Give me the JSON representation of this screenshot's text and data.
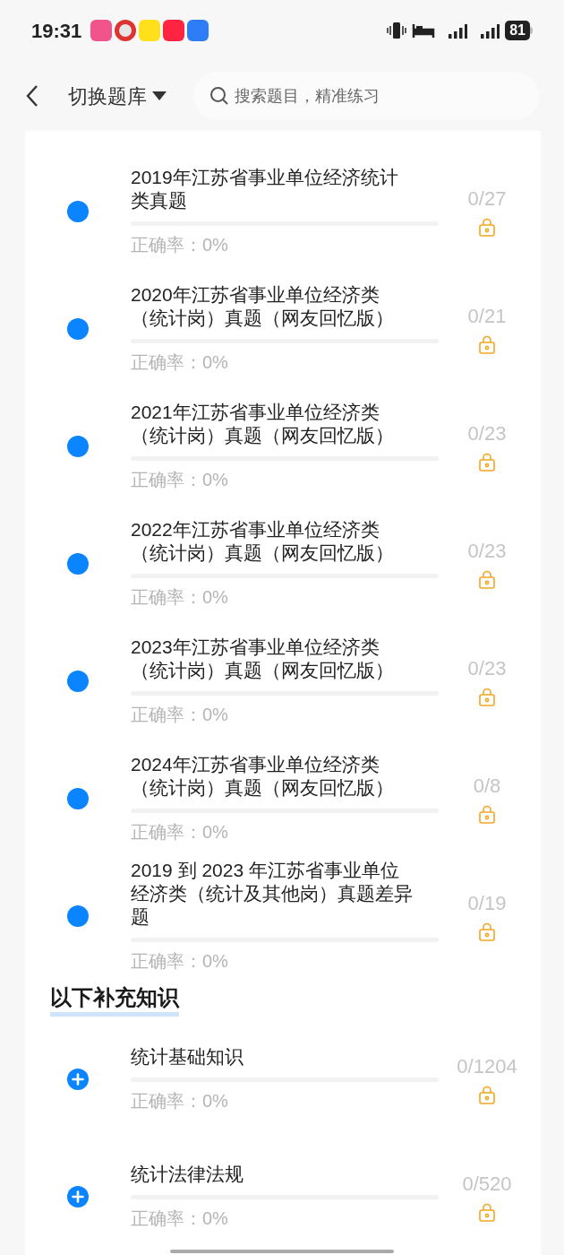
{
  "status_bar": {
    "time": "19:31",
    "battery": "81"
  },
  "header": {
    "title": "切换题库",
    "search": {
      "placeholder": "搜索题目，精准练习"
    }
  },
  "sections": [
    {
      "items": [
        {
          "kind": "dot",
          "title_lines": [
            "2019年江苏省事业单位经济统计",
            "类真题"
          ],
          "count": "0/27",
          "accuracy": "正确率：0%",
          "locked": true
        },
        {
          "kind": "dot",
          "title_lines": [
            "2020年江苏省事业单位经济类",
            "（统计岗）真题（网友回忆版）"
          ],
          "count": "0/21",
          "accuracy": "正确率：0%",
          "locked": true
        },
        {
          "kind": "dot",
          "title_lines": [
            "2021年江苏省事业单位经济类",
            "（统计岗）真题（网友回忆版）"
          ],
          "count": "0/23",
          "accuracy": "正确率：0%",
          "locked": true
        },
        {
          "kind": "dot",
          "title_lines": [
            "2022年江苏省事业单位经济类",
            "（统计岗）真题（网友回忆版）"
          ],
          "count": "0/23",
          "accuracy": "正确率：0%",
          "locked": true
        },
        {
          "kind": "dot",
          "title_lines": [
            "2023年江苏省事业单位经济类",
            "（统计岗）真题（网友回忆版）"
          ],
          "count": "0/23",
          "accuracy": "正确率：0%",
          "locked": true
        },
        {
          "kind": "dot",
          "title_lines": [
            "2024年江苏省事业单位经济类",
            "（统计岗）真题（网友回忆版）"
          ],
          "count": "0/8",
          "accuracy": "正确率：0%",
          "locked": true
        },
        {
          "kind": "dot",
          "title_lines": [
            "2019 到 2023 年江苏省事业单位",
            "经济类（统计及其他岗）真题差异",
            "题"
          ],
          "count": "0/19",
          "accuracy": "正确率：0%",
          "locked": true
        }
      ]
    },
    {
      "heading": "以下补充知识",
      "items": [
        {
          "kind": "plus",
          "title_lines": [
            "统计基础知识"
          ],
          "count": "0/1204",
          "accuracy": "正确率：0%",
          "locked": true
        },
        {
          "kind": "plus",
          "title_lines": [
            "统计法律法规"
          ],
          "count": "0/520",
          "accuracy": "正确率：0%",
          "locked": true
        }
      ]
    }
  ]
}
